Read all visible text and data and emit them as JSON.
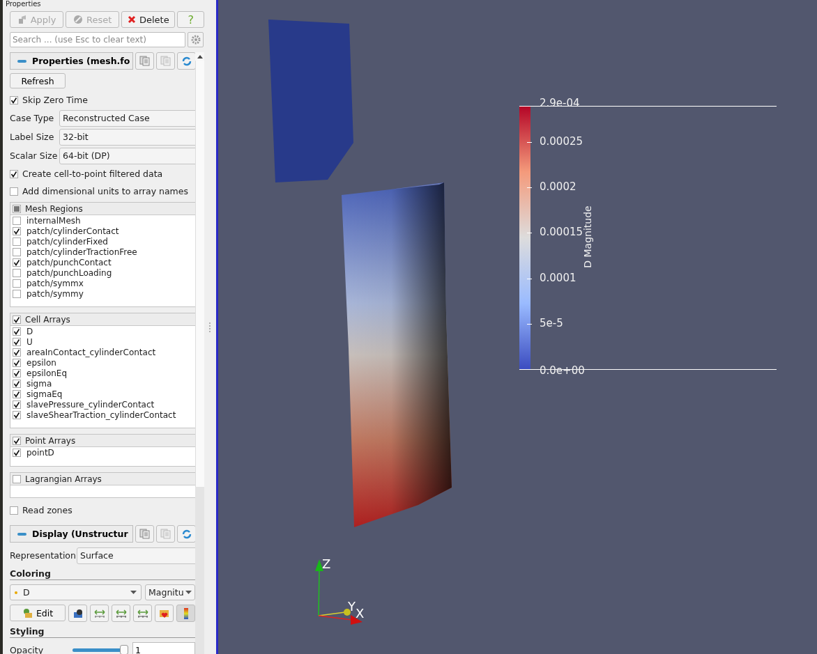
{
  "panel": {
    "title": "Properties"
  },
  "toolbar": [
    {
      "kind": "apply",
      "label": "Apply",
      "disabled": true
    },
    {
      "kind": "reset",
      "label": "Reset",
      "disabled": true
    },
    {
      "kind": "delete",
      "label": "Delete",
      "disabled": false
    },
    {
      "kind": "help",
      "label": "?",
      "disabled": false
    }
  ],
  "search": {
    "placeholder": "Search ... (use Esc to clear text)"
  },
  "rows": [
    {
      "kind": "section",
      "label": "Properties (mesh.fo"
    },
    {
      "kind": "button",
      "label": "Refresh"
    },
    {
      "kind": "checkbox",
      "label": "Skip Zero Time",
      "checked": true
    },
    {
      "kind": "combo",
      "label": "Case Type",
      "value": "Reconstructed Case"
    },
    {
      "kind": "combo",
      "label": "Label Size",
      "value": "32-bit"
    },
    {
      "kind": "combo",
      "label": "Scalar Size",
      "value": "64-bit (DP)"
    },
    {
      "kind": "checkbox",
      "label": "Create cell-to-point filtered data",
      "checked": true
    },
    {
      "kind": "checkbox",
      "label": "Add dimensional units to array names",
      "checked": false
    },
    {
      "kind": "list",
      "header": "Mesh Regions",
      "header_checked": false,
      "header_partial": true,
      "items": [
        {
          "label": "internalMesh",
          "checked": false
        },
        {
          "label": "patch/cylinderContact",
          "checked": true
        },
        {
          "label": "patch/cylinderFixed",
          "checked": false
        },
        {
          "label": "patch/cylinderTractionFree",
          "checked": false
        },
        {
          "label": "patch/punchContact",
          "checked": true
        },
        {
          "label": "patch/punchLoading",
          "checked": false
        },
        {
          "label": "patch/symmx",
          "checked": false
        },
        {
          "label": "patch/symmy",
          "checked": false
        }
      ]
    },
    {
      "kind": "list",
      "header": "Cell Arrays",
      "header_checked": true,
      "items": [
        {
          "label": "D",
          "checked": true
        },
        {
          "label": "U",
          "checked": true
        },
        {
          "label": "areaInContact_cylinderContact",
          "checked": true
        },
        {
          "label": "epsilon",
          "checked": true
        },
        {
          "label": "epsilonEq",
          "checked": true
        },
        {
          "label": "sigma",
          "checked": true
        },
        {
          "label": "sigmaEq",
          "checked": true
        },
        {
          "label": "slavePressure_cylinderContact",
          "checked": true
        },
        {
          "label": "slaveShearTraction_cylinderContact",
          "checked": true
        }
      ]
    },
    {
      "kind": "list",
      "header": "Point Arrays",
      "header_checked": true,
      "items": [
        {
          "label": "pointD",
          "checked": true
        }
      ]
    },
    {
      "kind": "list",
      "header": "Lagrangian Arrays",
      "header_checked": false
    },
    {
      "kind": "checkbox",
      "label": "Read zones",
      "checked": false
    },
    {
      "kind": "section",
      "label": "Display (Unstructur"
    },
    {
      "kind": "combo",
      "label": "Representation",
      "value": "Surface"
    },
    {
      "kind": "heading",
      "label": "Coloring"
    },
    {
      "kind": "color_combo",
      "value": "D",
      "component": "Magnitu"
    },
    {
      "kind": "icon_toolbar",
      "label": "Edit"
    },
    {
      "kind": "heading",
      "label": "Styling"
    },
    {
      "kind": "slider",
      "label": "Opacity",
      "level": 0.93,
      "value": "1"
    }
  ],
  "viewport": {
    "legend": {
      "title": "D Magnitude",
      "ticks": [
        "2.9e-04",
        "0.00025",
        "0.0002",
        "0.00015",
        "0.0001",
        "5e-5",
        "0.0e+00"
      ]
    },
    "axes": [
      "Z",
      "Y",
      "X"
    ]
  }
}
